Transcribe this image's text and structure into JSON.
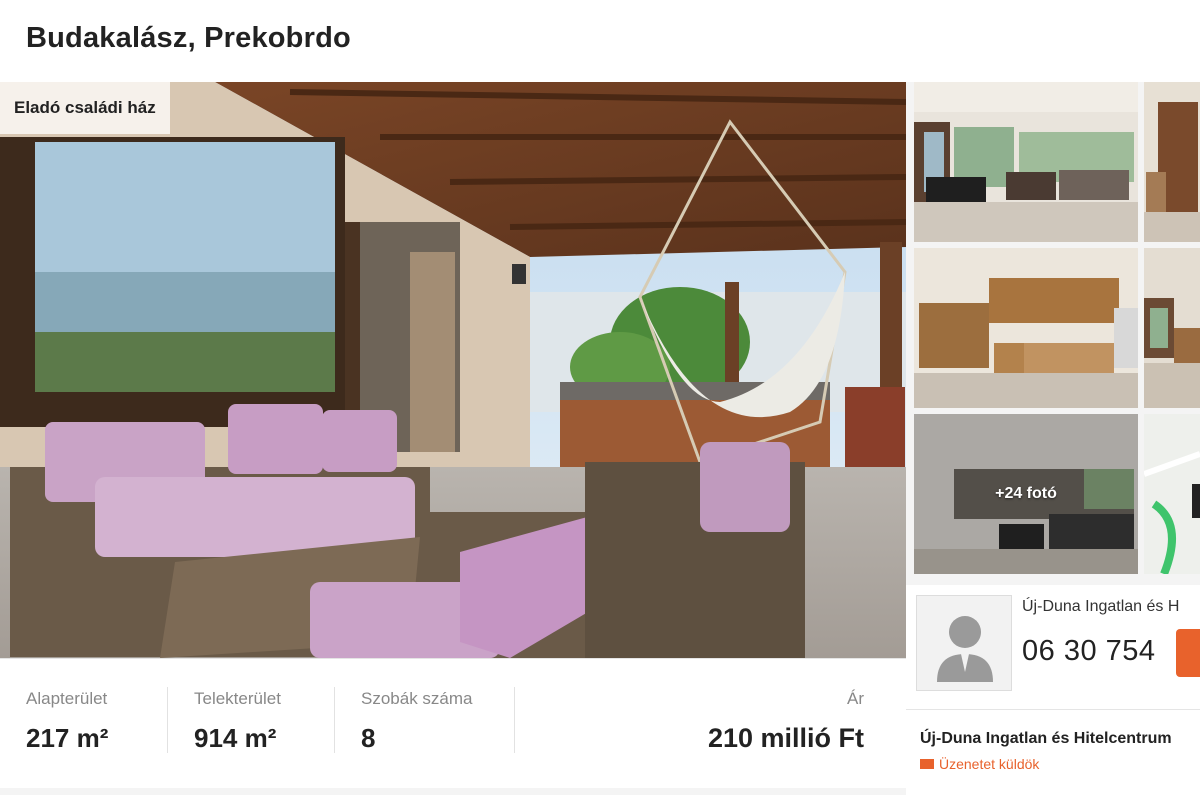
{
  "listing": {
    "title": "Budakalász, Prekobrdo",
    "property_type": "Eladó családi ház"
  },
  "gallery": {
    "more_photos_label": "+24 fotó",
    "thumbnails": [
      "living-room",
      "bookshelf-room",
      "kitchen",
      "dining-room",
      "open-living-area",
      "map"
    ]
  },
  "stats": {
    "area_label": "Alapterület",
    "area_value": "217 m²",
    "plot_label": "Telekterület",
    "plot_value": "914 m²",
    "rooms_label": "Szobák száma",
    "rooms_value": "8",
    "price_label": "Ár",
    "price_value": "210 millió Ft"
  },
  "agent": {
    "name": "Új-Duna Ingatlan és H",
    "phone": "06 30 754",
    "office_name": "Új-Duna Ingatlan és Hitelcentrum",
    "message_label": "Üzenetet küldök"
  },
  "colors": {
    "accent": "#e8622c"
  }
}
